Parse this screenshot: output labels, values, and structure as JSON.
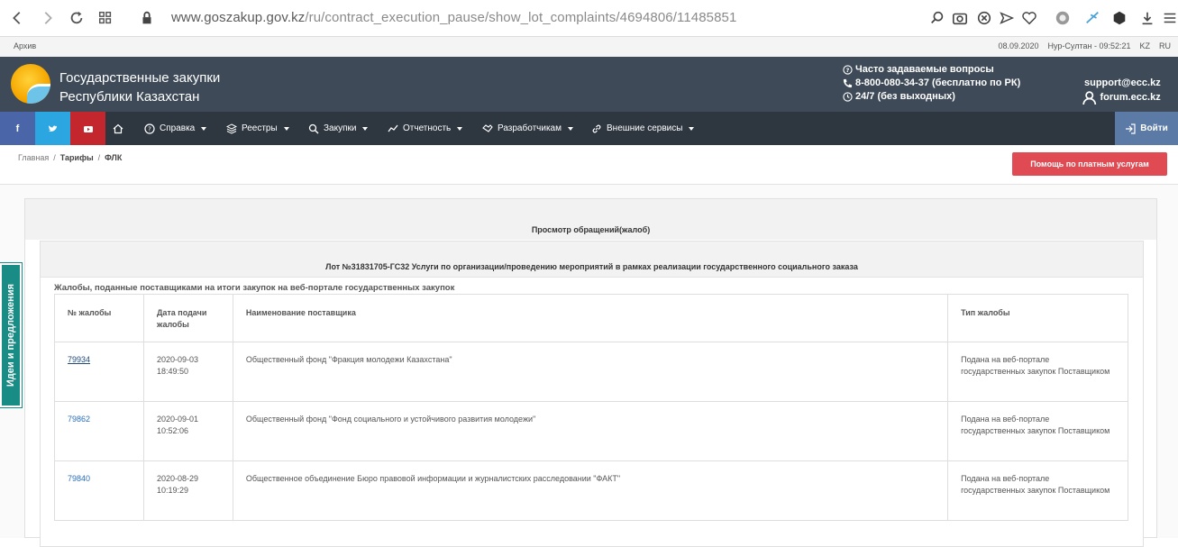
{
  "browser": {
    "url_host": "www.goszakup.gov.kz",
    "url_path": "/ru/contract_execution_pause/show_lot_complaints/4694806/11485851"
  },
  "top_strip": {
    "archive": "Архив",
    "date": "08.09.2020",
    "city_time": "Нур-Султан - 09:52:21",
    "lang_kz": "KZ",
    "lang_ru": "RU"
  },
  "header": {
    "title_line1": "Государственные закупки",
    "title_line2": "Республики Казахстан",
    "faq": "Часто задаваемые вопросы",
    "phone": "8-800-080-34-37 (бесплатно по РК)",
    "hours": "24/7 (без выходных)",
    "email": "support@ecc.kz",
    "forum": "forum.ecc.kz"
  },
  "nav": {
    "items": [
      {
        "label": "Справка"
      },
      {
        "label": "Реестры"
      },
      {
        "label": "Закупки"
      },
      {
        "label": "Отчетность"
      },
      {
        "label": "Разработчикам"
      },
      {
        "label": "Внешние сервисы"
      }
    ],
    "login": "Войти"
  },
  "colors": {
    "header_bg": "#3e4a58",
    "navbar_bg": "#2e3640",
    "facebook": "#4a65a8",
    "twitter": "#2ba6e0",
    "youtube": "#c4262d",
    "login_bg": "#5b7aa6",
    "help_button": "#e04a52",
    "side_tab": "#1a8c86"
  },
  "breadcrumb": [
    "Главная",
    "Тарифы",
    "ФЛК"
  ],
  "help_button": "Помощь по платным услугам",
  "panel_title": "Просмотр обращений(жалоб)",
  "lot_title": "Лот №31831705-ГС32 Услуги по организации/проведению мероприятий в рамках реализации государственного социального заказа",
  "section_label": "Жалобы, поданные поставщиками на итоги закупок на веб-портале государственных закупок",
  "table": {
    "headers": [
      "№ жалобы",
      "Дата подачи жалобы",
      "Наименование поставщика",
      "Тип жалобы"
    ],
    "rows": [
      {
        "id": "79934",
        "date": "2020-09-03",
        "time": "18:49:50",
        "supplier": "Общественный фонд \"Фракция молодежи Казахстана\"",
        "type": "Подана на веб-портале государственных закупок Поставщиком"
      },
      {
        "id": "79862",
        "date": "2020-09-01",
        "time": "10:52:06",
        "supplier": "Общественный фонд \"Фонд социального и устойчивого развития молодежи\"",
        "type": "Подана на веб-портале государственных закупок Поставщиком"
      },
      {
        "id": "79840",
        "date": "2020-08-29",
        "time": "10:19:29",
        "supplier": "Общественное объединение Бюро правовой информации и журналистских расследовании \"ФАКТ\"",
        "type": "Подана на веб-портале государственных закупок Поставщиком"
      }
    ]
  },
  "side_tab": "Идеи и предложения"
}
